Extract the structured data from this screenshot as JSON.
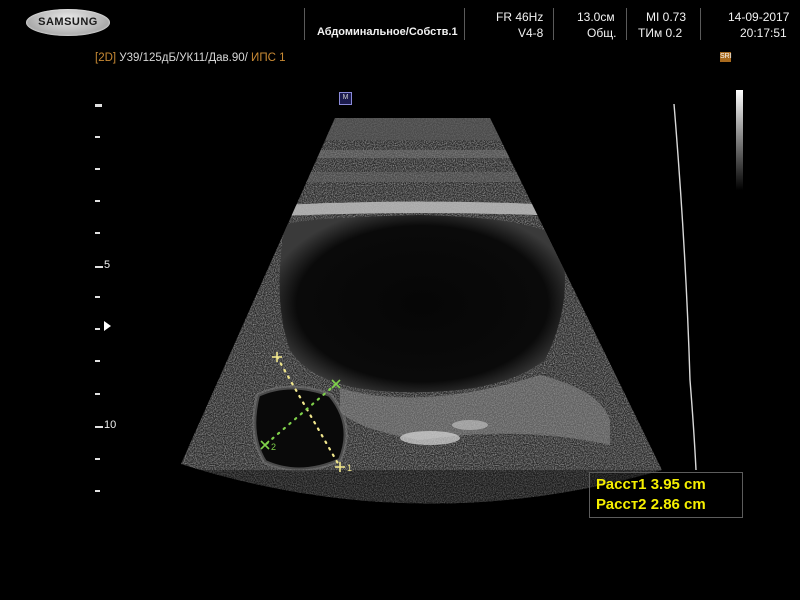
{
  "header": {
    "brand": "SAMSUNG",
    "preset": "Абдоминальное/Собств.1",
    "frame_rate": "FR 46Hz",
    "probe": "V4-8",
    "depth": "13.0см",
    "mode_general": "Общ.",
    "mi": "MI 0.73",
    "tim": "ТИм 0.2",
    "date": "14-09-2017",
    "time": "20:17:51"
  },
  "mode_line": {
    "mode": "[2D]",
    "settings": "У39/125дБ/УК11/Дав.90/",
    "ips": "ИПС 1"
  },
  "icons": {
    "sri_badge": "SRI",
    "marker_m": "M"
  },
  "depth_scale": {
    "label_5": "5",
    "label_10": "10"
  },
  "calipers": {
    "label_1": "1",
    "label_2": "2"
  },
  "measurements": {
    "dist1": "Расст1 3.95 cm",
    "dist2": "Расст2 2.86 cm"
  },
  "colors": {
    "measurement_text": "#f6f000",
    "mode_text": "#c98a34",
    "caliper_1": "#f0e68c",
    "caliper_2": "#7fd04a"
  }
}
